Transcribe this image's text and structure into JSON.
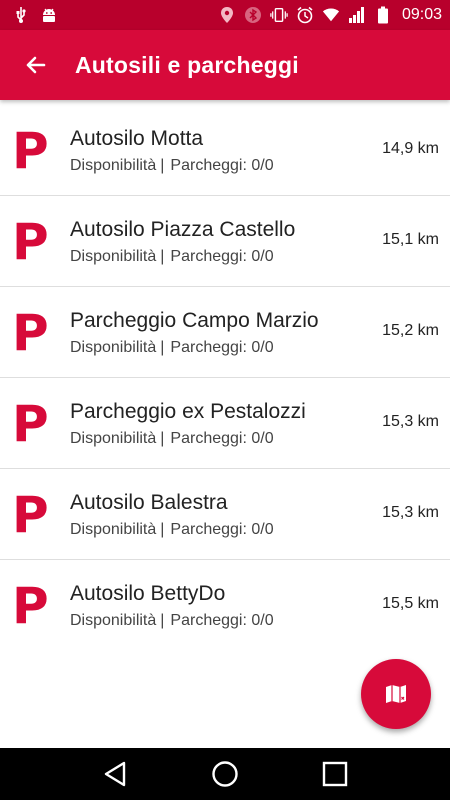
{
  "status_bar": {
    "time": "09:03",
    "icons": [
      "usb-icon",
      "android-debug-icon",
      "location-icon",
      "bluetooth-icon",
      "vibrate-icon",
      "alarm-icon",
      "wifi-icon",
      "signal-icon",
      "battery-icon"
    ]
  },
  "app_bar": {
    "title": "Autosili e parcheggi",
    "back_icon": "arrow-back-icon"
  },
  "parking_list": [
    {
      "icon_letter": "P",
      "name": "Autosilo Motta",
      "availability_label": "Disponibilità",
      "separator": "|",
      "parking_label": "Parcheggi: 0/0",
      "distance": "14,9 km"
    },
    {
      "icon_letter": "P",
      "name": "Autosilo Piazza Castello",
      "availability_label": "Disponibilità",
      "separator": "|",
      "parking_label": "Parcheggi: 0/0",
      "distance": "15,1 km"
    },
    {
      "icon_letter": "P",
      "name": "Parcheggio Campo Marzio",
      "availability_label": "Disponibilità",
      "separator": "|",
      "parking_label": "Parcheggi: 0/0",
      "distance": "15,2 km"
    },
    {
      "icon_letter": "P",
      "name": "Parcheggio ex Pestalozzi",
      "availability_label": "Disponibilità",
      "separator": "|",
      "parking_label": "Parcheggi: 0/0",
      "distance": "15,3 km"
    },
    {
      "icon_letter": "P",
      "name": "Autosilo Balestra",
      "availability_label": "Disponibilità",
      "separator": "|",
      "parking_label": "Parcheggi: 0/0",
      "distance": "15,3 km"
    },
    {
      "icon_letter": "P",
      "name": "Autosilo BettyDo",
      "availability_label": "Disponibilità",
      "separator": "|",
      "parking_label": "Parcheggi: 0/0",
      "distance": "15,5 km"
    }
  ],
  "fab": {
    "icon": "map-icon"
  },
  "nav_bar": {
    "icons": [
      "back-triangle-icon",
      "home-circle-icon",
      "recents-square-icon"
    ]
  },
  "colors": {
    "accent": "#d70a3a",
    "status_bar": "#b8002c",
    "nav_bar": "#000000"
  }
}
